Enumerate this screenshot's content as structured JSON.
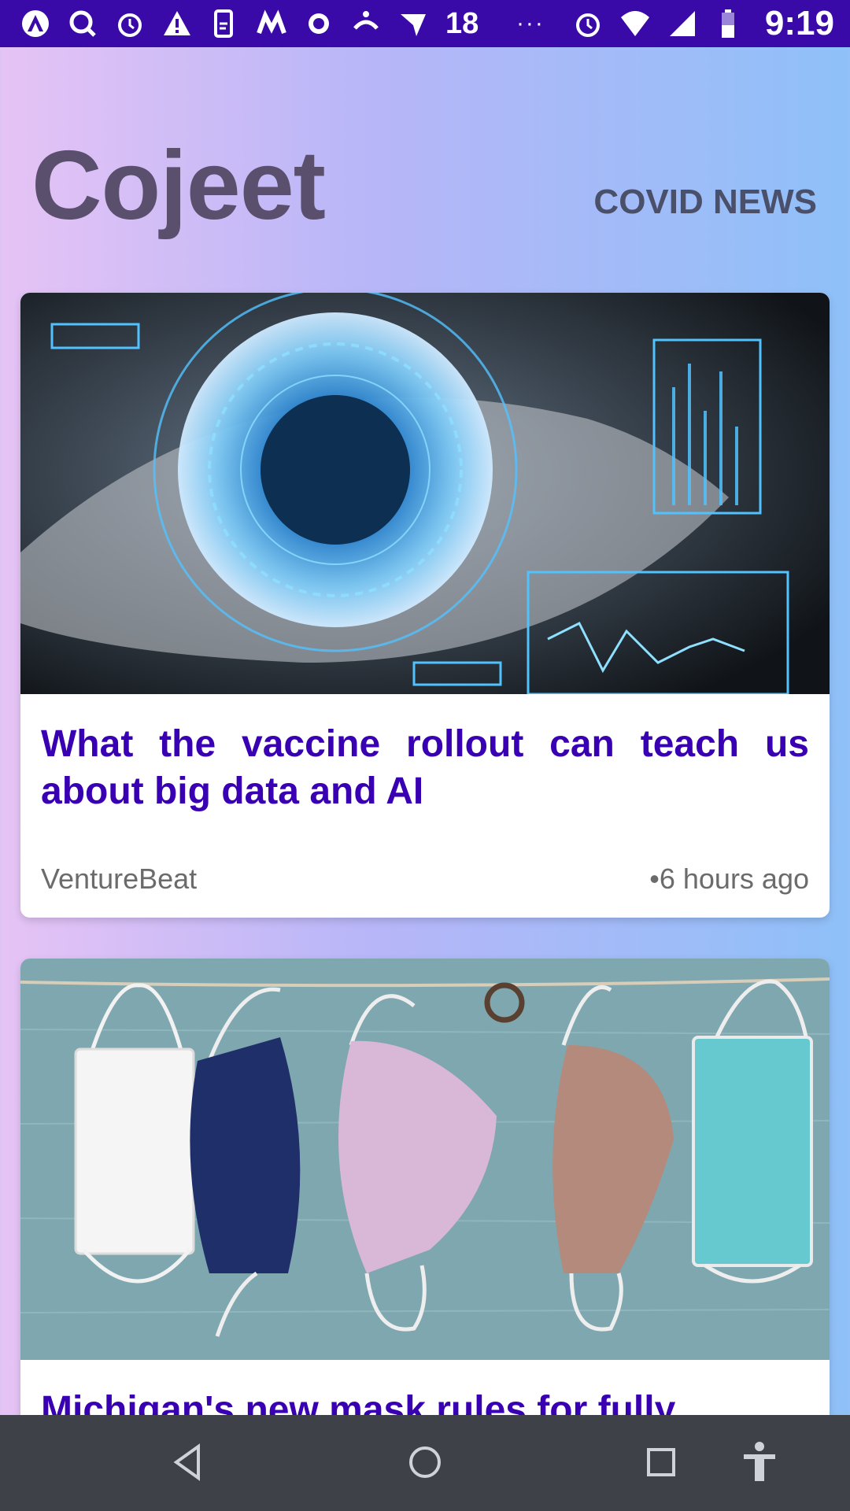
{
  "status_bar": {
    "notification_count": "18",
    "overflow": "···",
    "time": "9:19"
  },
  "header": {
    "app_title": "Cojeet",
    "section_label": "COVID NEWS"
  },
  "articles": [
    {
      "title": "What the vaccine rollout can teach us about big data and AI",
      "source": "VentureBeat",
      "time": "•6 hours ago",
      "image_icon": "eye-scan-image"
    },
    {
      "title": "Michigan's new mask rules for fully",
      "image_icon": "face-masks-image"
    }
  ],
  "nav": {
    "back_icon": "back-triangle-icon",
    "home_icon": "home-circle-icon",
    "recents_icon": "recents-square-icon",
    "accessibility_icon": "accessibility-icon"
  },
  "colors": {
    "status_bar": "#3a0aa8",
    "title_text": "#3900b3",
    "app_title": "#5a4f6c",
    "nav_bar": "#3f4148"
  }
}
